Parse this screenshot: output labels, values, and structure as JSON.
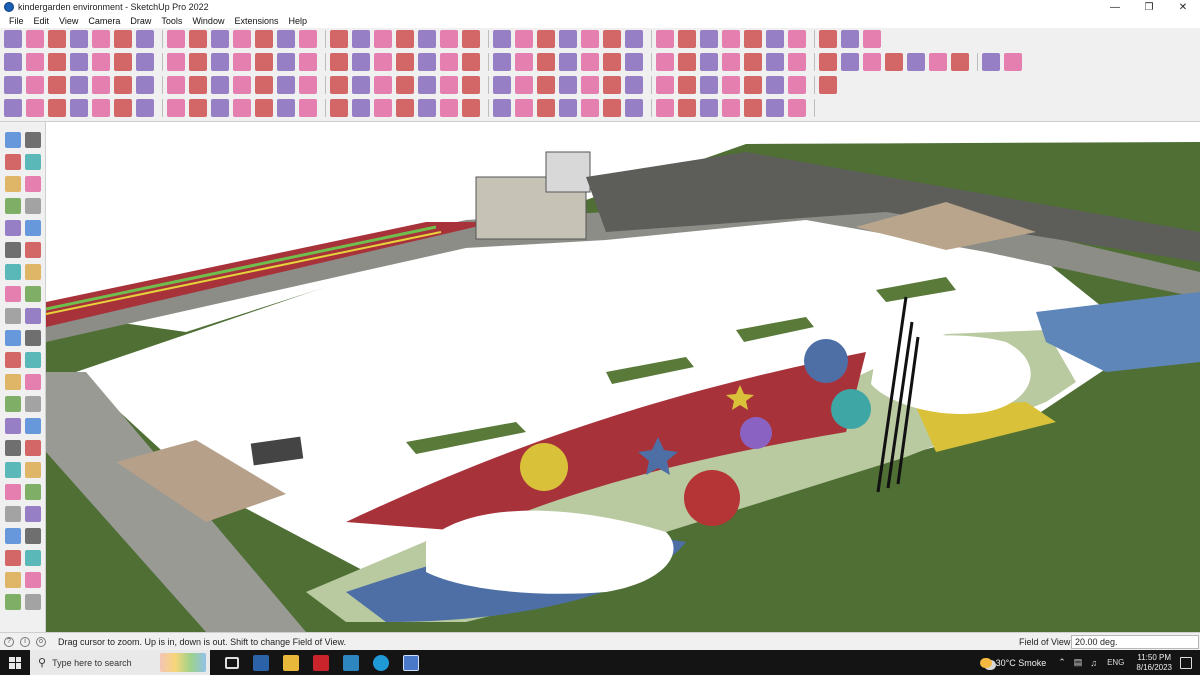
{
  "window": {
    "title": "kindergarden environment - SketchUp Pro 2022",
    "controls": [
      "minimize-icon",
      "restore-icon",
      "close-icon"
    ]
  },
  "menu": [
    "File",
    "Edit",
    "View",
    "Camera",
    "Draw",
    "Tools",
    "Window",
    "Extensions",
    "Help"
  ],
  "left_tool_labels": {
    "tape": "A1"
  },
  "status": {
    "hint": "Drag cursor to zoom.  Up is in, down is out. Shift to change Field of View.",
    "measure_label": "Field of View",
    "measure_value": "20.00 deg."
  },
  "taskbar": {
    "search_placeholder": "Type here to search",
    "weather": "30°C  Smoke",
    "language": "ENG",
    "time": "11:50 PM",
    "date": "8/16/2023"
  },
  "colors": {
    "ground_green": "#4f6f35",
    "paving_grey": "#8f8f8a",
    "track_red": "#a8323a",
    "play_lightgreen": "#b9c9a0",
    "play_blue": "#4d6fa6",
    "play_yellow": "#d9c23a",
    "play_purple": "#8a62c2",
    "play_teal": "#3fa6a6"
  }
}
